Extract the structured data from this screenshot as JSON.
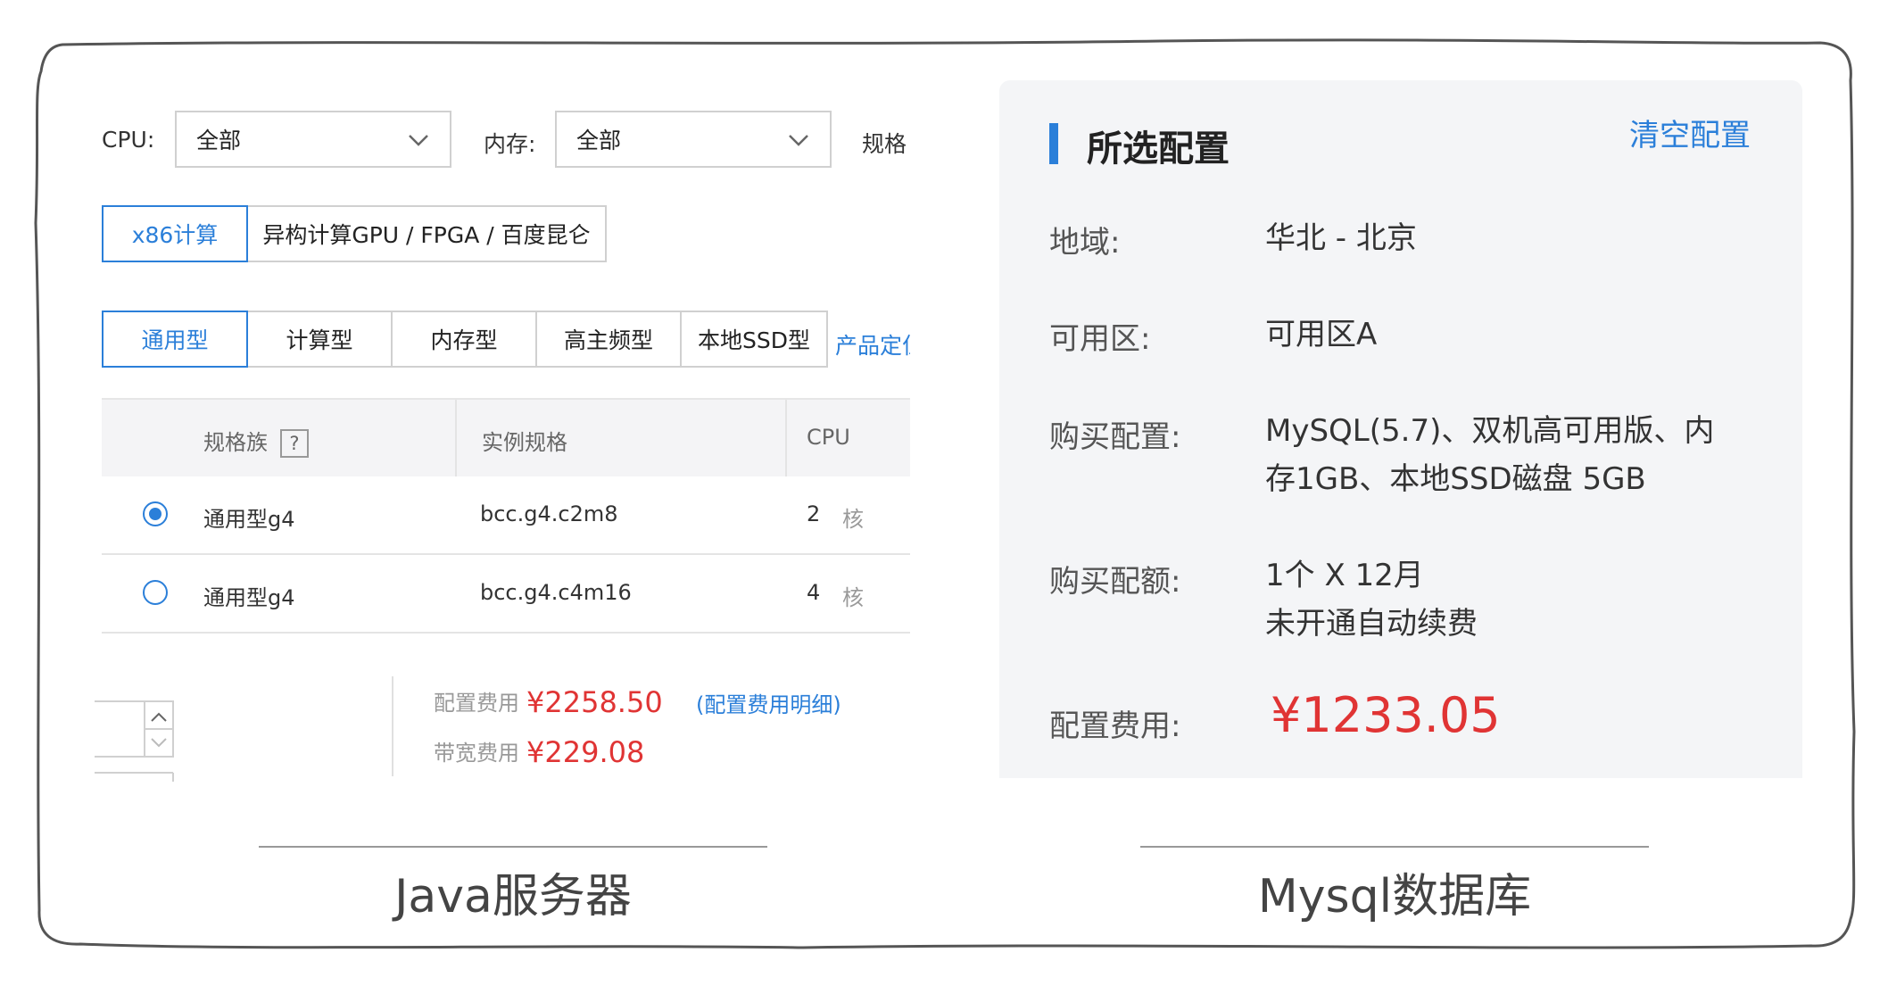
{
  "java_panel": {
    "filters": {
      "cpu_label": "CPU:",
      "cpu_value": "全部",
      "mem_label": "内存:",
      "mem_value": "全部",
      "spec_label": "规格"
    },
    "arch_tabs": [
      "x86计算",
      "异构计算GPU / FPGA / 百度昆仑"
    ],
    "type_tabs": [
      "通用型",
      "计算型",
      "内存型",
      "高主频型",
      "本地SSD型"
    ],
    "product_link": "产品定位",
    "table": {
      "headers": [
        "规格族",
        "实例规格",
        "CPU"
      ],
      "help_mark": "?",
      "rows": [
        {
          "family": "通用型g4",
          "spec": "bcc.g4.c2m8",
          "cpu": "2",
          "unit": "核",
          "selected": true
        },
        {
          "family": "通用型g4",
          "spec": "bcc.g4.c4m16",
          "cpu": "4",
          "unit": "核",
          "selected": false
        }
      ]
    },
    "fees": {
      "config_label": "配置费用",
      "config_value": "¥2258.50",
      "detail_link": "(配置费用明细)",
      "bandwidth_label": "带宽费用",
      "bandwidth_value": "¥229.08"
    },
    "caption": "Java服务器"
  },
  "mysql_panel": {
    "title": "所选配置",
    "clear_link": "清空配置",
    "rows": [
      {
        "label": "地域:",
        "value": "华北 - 北京"
      },
      {
        "label": "可用区:",
        "value": "可用区A"
      },
      {
        "label": "购买配置:",
        "value_lines": [
          "MySQL(5.7)、双机高可用版、内",
          "存1GB、本地SSD磁盘 5GB"
        ]
      },
      {
        "label": "购买配额:",
        "value_lines": [
          "1个 X 12月",
          "未开通自动续费"
        ]
      },
      {
        "label": "配置费用:",
        "value": "¥1233.05"
      }
    ],
    "caption": "Mysql数据库"
  },
  "colors": {
    "accent": "#2b7fd9",
    "price": "#e03434",
    "panel_bg": "#f4f5f7"
  }
}
